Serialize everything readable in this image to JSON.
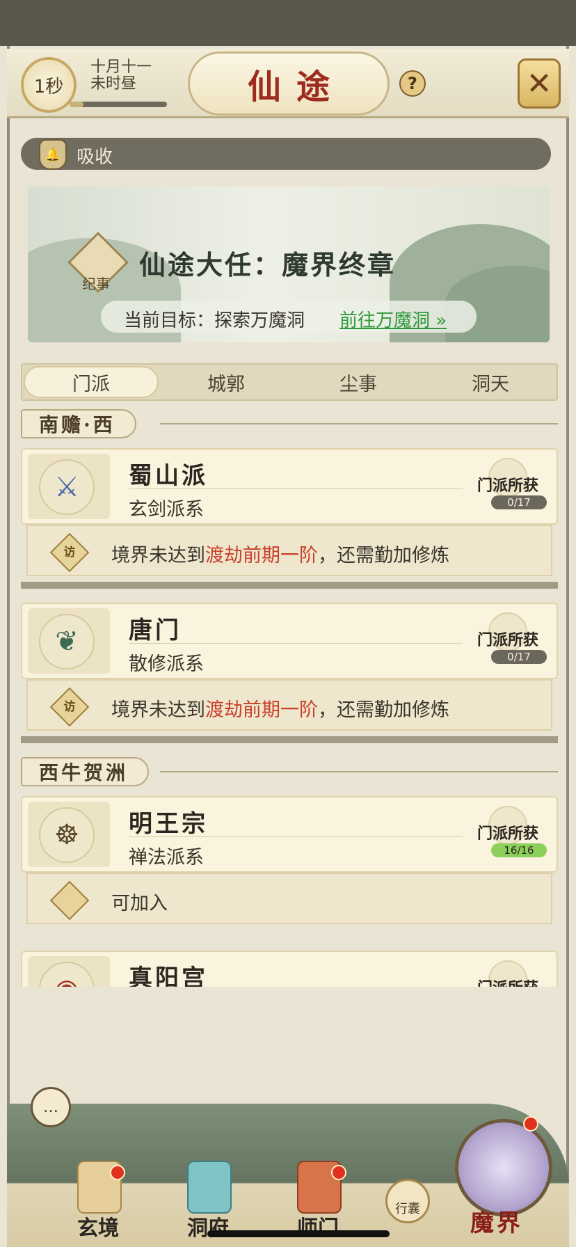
{
  "header": {
    "timer": "1秒",
    "date_line1": "十月十一",
    "date_line2": "未时昼",
    "title": "仙途",
    "help": "?",
    "close": "✕"
  },
  "absorb": {
    "label": "吸收",
    "progress": 0.2
  },
  "quest": {
    "saga_label": "纪事",
    "title": "仙途大任：魔界终章",
    "goal_label": "当前目标：探索万魔洞",
    "goal_link": "前往万魔洞 »"
  },
  "tabs": [
    "门派",
    "城郭",
    "尘事",
    "洞天"
  ],
  "regions": [
    "南赡·西",
    "西牛贺洲"
  ],
  "sects": [
    {
      "name": "蜀山派",
      "school": "玄剑派系",
      "reward_label": "门派所获",
      "reward_count": "0/17",
      "req_prefix": "境界未达到",
      "req_highlight": "渡劫前期一阶",
      "req_suffix": "，还需勤加修炼",
      "req_icon": "访"
    },
    {
      "name": "唐门",
      "school": "散修派系",
      "reward_label": "门派所获",
      "reward_count": "0/17",
      "req_prefix": "境界未达到",
      "req_highlight": "渡劫前期一阶",
      "req_suffix": "，还需勤加修炼",
      "req_icon": "访"
    },
    {
      "name": "明王宗",
      "school": "禅法派系",
      "reward_label": "门派所获",
      "reward_count": "16/16",
      "req_text": "可加入"
    },
    {
      "name": "真阳宫",
      "reward_label": "门派所获"
    }
  ],
  "nav": {
    "items": [
      "玄境",
      "洞府",
      "师门"
    ],
    "bag": "行囊",
    "demon": "魔界",
    "chat_icon": "chat-bubble-icon"
  },
  "colors": {
    "title_red": "#9d2c1f",
    "highlight_red": "#c9402a",
    "link_green": "#2e9a3a",
    "badge_red": "#e0301e"
  }
}
